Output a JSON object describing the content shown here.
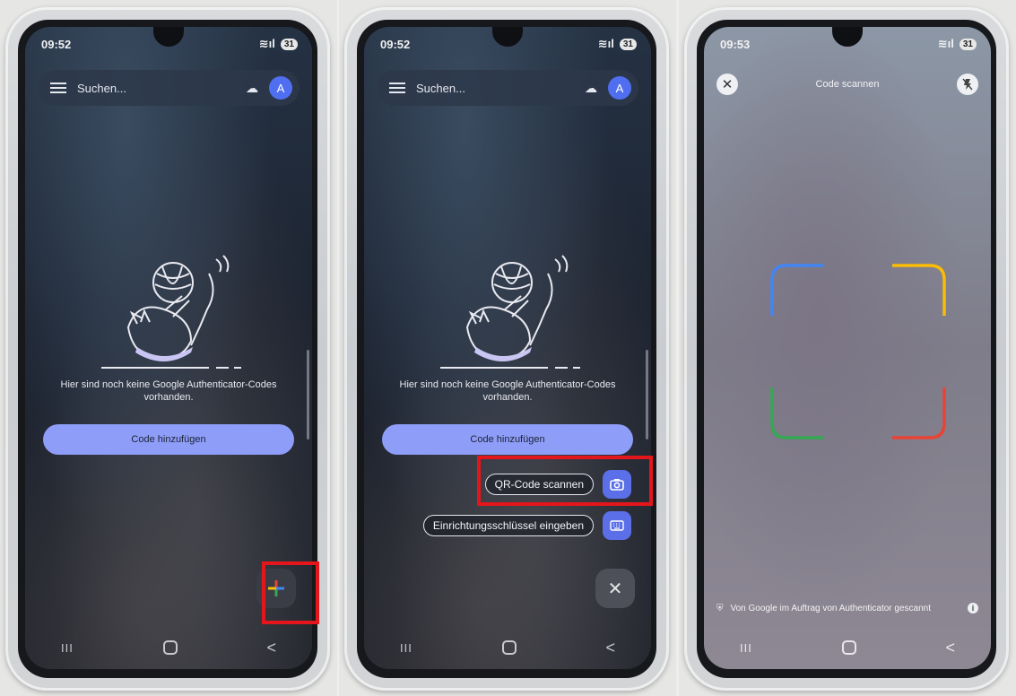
{
  "status": {
    "time_1": "09:52",
    "time_2": "09:52",
    "time_3": "09:53",
    "battery": "31"
  },
  "app_header": {
    "search_placeholder": "Suchen...",
    "avatar_initial": "A"
  },
  "empty_state": {
    "message": "Hier sind noch keine Google Authenticator-Codes vorhanden.",
    "add_code_label": "Code hinzufügen"
  },
  "add_menu": {
    "scan_qr_label": "QR-Code scannen",
    "enter_key_label": "Einrichtungsschlüssel eingeben"
  },
  "scanner": {
    "title": "Code scannen",
    "footer_text": "Von Google im Auftrag von Authenticator gescannt"
  },
  "nav": {
    "recent": "III",
    "back": "<"
  },
  "colors": {
    "accent": "#8e9df7",
    "highlight": "#e4161b",
    "google_blue": "#4285f4",
    "google_red": "#ea4335",
    "google_yellow": "#fbbc05",
    "google_green": "#34a853"
  },
  "icons": [
    "menu-icon",
    "cloud-icon",
    "camera-icon",
    "keyboard-icon",
    "close-icon",
    "flash-off-icon",
    "shield-icon",
    "info-icon",
    "plus-icon"
  ]
}
